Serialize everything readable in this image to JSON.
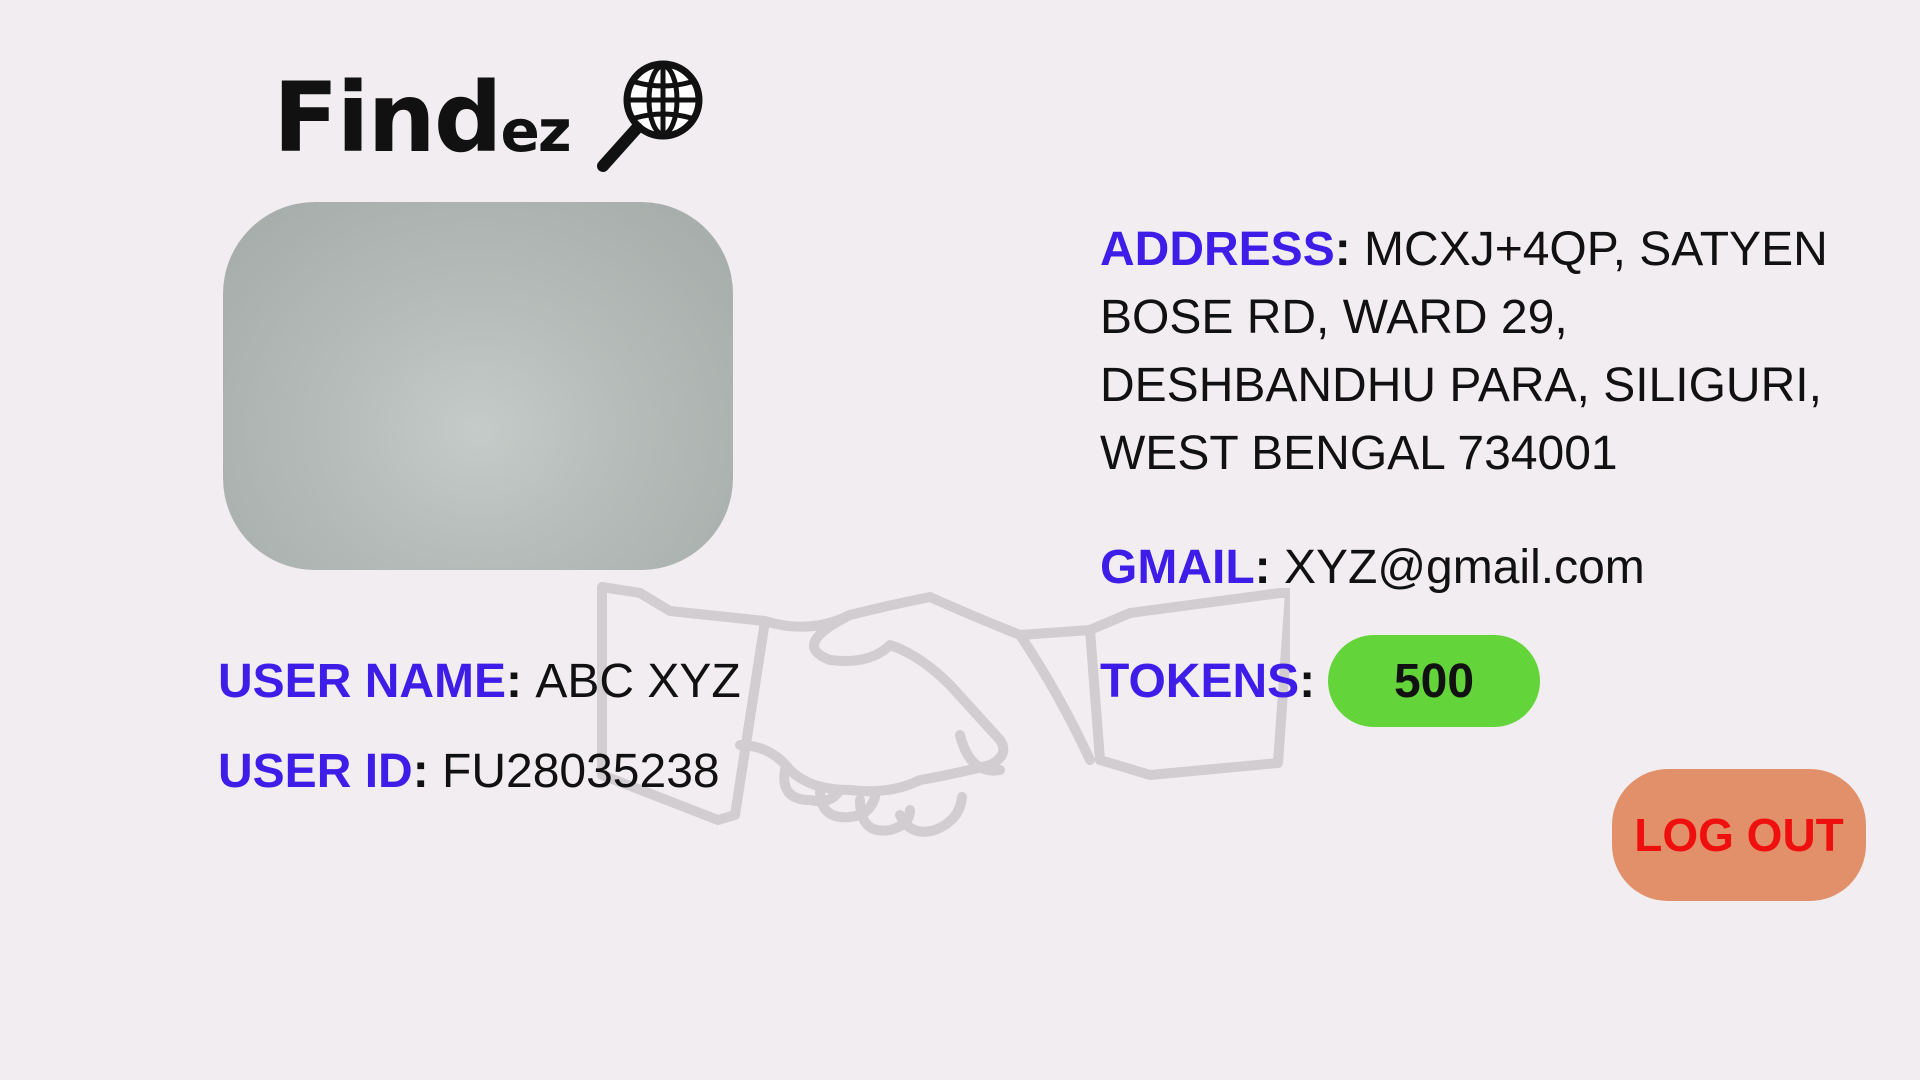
{
  "logo": {
    "text_main": "Find",
    "text_suffix": "ez",
    "icon": "magnifier-globe-icon"
  },
  "profile": {
    "avatar": "avatar-placeholder",
    "username_key": "USER NAME",
    "username_value": "ABC XYZ",
    "userid_key": "USER ID",
    "userid_value": "FU28035238"
  },
  "details": {
    "address_key": "ADDRESS",
    "address_value": "MCXJ+4QP, SATYEN BOSE RD, WARD 29, DESHBANDHU PARA, SILIGURI, WEST BENGAL 734001",
    "gmail_key": "GMAIL",
    "gmail_value": "XYZ@gmail.com",
    "tokens_key": "TOKENS",
    "tokens_value": "500"
  },
  "actions": {
    "logout_label": "LOG OUT"
  },
  "background": {
    "watermark_icon": "handshake-icon"
  },
  "colors": {
    "background": "#f2edf0",
    "key_text": "#3f1de8",
    "token_pill": "#63d439",
    "logout_bg": "#e2906a",
    "logout_text": "#f00f0f"
  }
}
